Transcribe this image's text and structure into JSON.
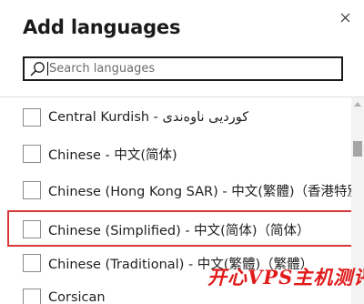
{
  "dialog": {
    "title": "Add languages",
    "close_icon": "close-icon",
    "search": {
      "placeholder": "Search languages",
      "value": "",
      "icon": "search-icon"
    }
  },
  "languages": [
    {
      "label": "Central Kurdish - کوردیی ناوەندی",
      "checked": false
    },
    {
      "label": "Chinese - 中文(简体)",
      "checked": false
    },
    {
      "label": "Chinese (Hong Kong SAR) - 中文(繁體)（香港特別行",
      "checked": false
    },
    {
      "label": "Chinese (Simplified) - 中文(简体)（简体）",
      "checked": false,
      "highlighted": true
    },
    {
      "label": "Chinese (Traditional) - 中文(繁體)（繁體）",
      "checked": false
    },
    {
      "label": "Corsican",
      "checked": false
    }
  ],
  "highlight_color": "#d9383a",
  "watermark": "开心VPS主机测评",
  "watermark_color": "#e11a1a"
}
